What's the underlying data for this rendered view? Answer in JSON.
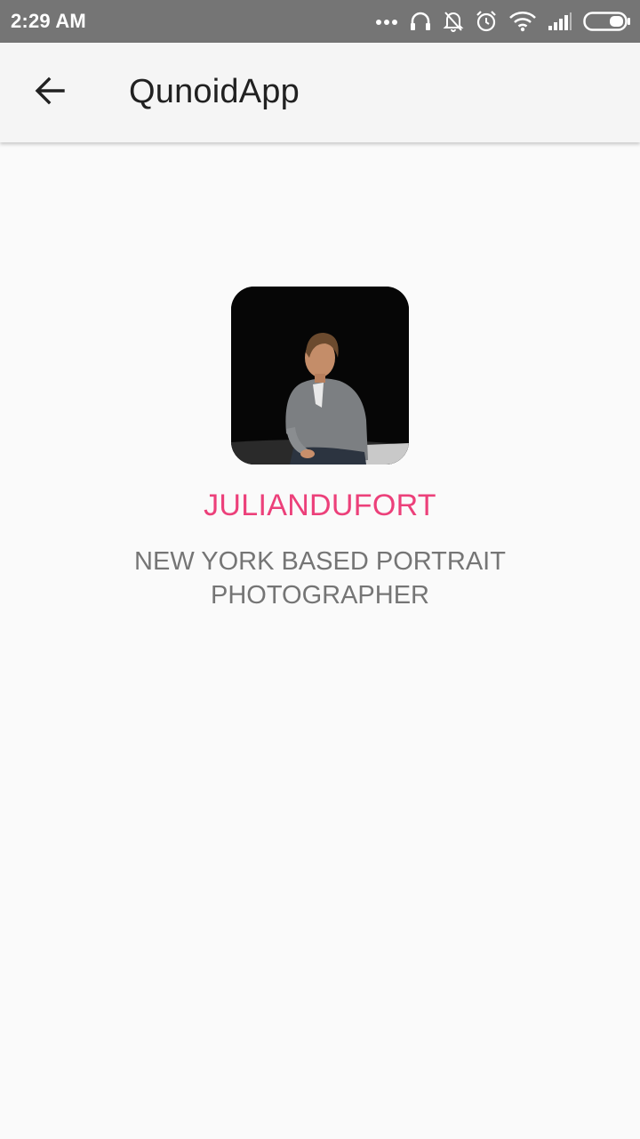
{
  "status_bar": {
    "time": "2:29 AM",
    "icons": [
      "more-dots-icon",
      "headset-icon",
      "bell-off-icon",
      "alarm-icon",
      "wifi-icon",
      "signal-icon",
      "battery-icon"
    ]
  },
  "app_bar": {
    "back_icon": "arrow-back-icon",
    "title": "QunoidApp"
  },
  "profile": {
    "avatar": "profile-photo",
    "username": "JULIANDUFORT",
    "bio": "NEW YORK BASED PORTRAIT PHOTOGRAPHER"
  },
  "colors": {
    "status_bar": "#757575",
    "app_bar": "#f5f5f5",
    "background": "#fafafa",
    "accent": "#ec407a",
    "title_text": "#212121",
    "secondary_text": "#757575"
  }
}
